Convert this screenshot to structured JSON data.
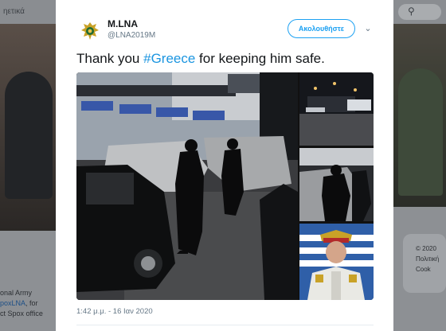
{
  "background_page": {
    "top_left_text": "ηετικά",
    "left_bottom_lines": [
      "onal Army",
      "poxLNA",
      ", for",
      "ct Spox office"
    ],
    "right_lines": [
      "© 2020",
      "Πολιτική",
      "Cook"
    ]
  },
  "tweet": {
    "author_name": "M.LNA",
    "author_handle": "@LNA2019M",
    "follow_label": "Ακολουθήστε",
    "text_before": "Thank you ",
    "hashtag": "#Greece",
    "text_after": " for keeping him safe.",
    "timestamp": "1:42 μ.μ. - 16 Ιαν 2020"
  },
  "icons": {
    "avatar": "lna-emblem-icon",
    "more": "chevron-down-icon",
    "search": "search-icon"
  },
  "colors": {
    "accent": "#1da1f2",
    "hashtag": "#1b95e0",
    "text": "#14171a",
    "secondary": "#657786"
  }
}
